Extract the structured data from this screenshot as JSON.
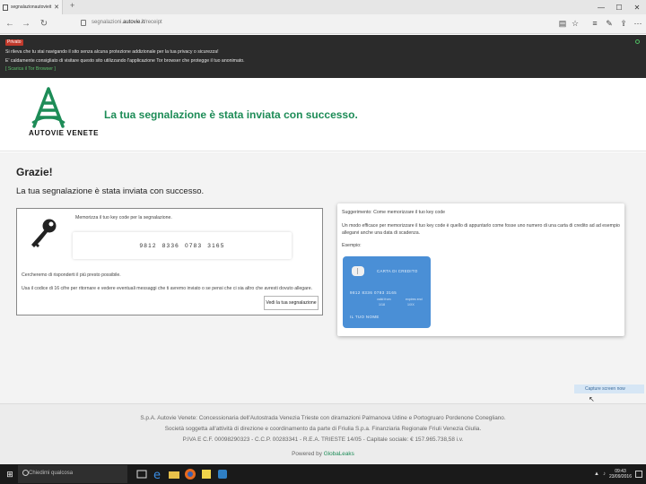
{
  "browser": {
    "tab_title": "segnalazionautovieit",
    "new_tab": "+",
    "window_controls": [
      "—",
      "☐",
      "✕"
    ],
    "url_prefix": "segnalazioni.",
    "url_domain": "autovie.it",
    "url_path": "/receipt",
    "nav": {
      "back": "←",
      "forward": "→",
      "refresh": "↻"
    },
    "toolbar_icons": [
      "reading-view-icon",
      "favorite-icon",
      "hub-icon",
      "note-icon",
      "share-icon",
      "more-icon"
    ]
  },
  "privacy_bar": {
    "badge": "Privato",
    "line1": "Si rileva che tu stai navigando il sito senza alcuna protezione addizionale per la tua privacy o sicurezza!",
    "line2": "E' caldamente consigliato di visitare questo sito utilizzando l'applicazione Tor browser che protegge il tuo anonimato.",
    "link": "[ Scarica il Tor Browser ]"
  },
  "header": {
    "logo_text": "AUTOVIE VENETE",
    "message": "La tua segnalazione è stata inviata con successo.",
    "accent_color": "#1d8c57"
  },
  "main": {
    "title": "Grazie!",
    "subtitle": "La tua segnalazione è stata inviata con successo.",
    "left_card": {
      "memorize": "Memorizza il tuo key code per la segnalazione.",
      "key_code": "9812 8336 0783 3165",
      "response": "Cercheremo di risponderti il più presto possibile.",
      "usage": "Usa il codice di 16 cifre per ritornare e vedere eventuali messaggi che ti avremo inviato o se pensi che ci sia altro che avresti dovuto allegare.",
      "view_button": "Vedi la tua segnalazione"
    },
    "right_card": {
      "tip": "Suggerimento: Come memorizzare il tuo key code",
      "line1": "Un modo efficace per memorizzare il tuo key code è quello di appuntarlo come fosse uno numero di una carta di credito ad ad esempio",
      "line2": "allegarvi anche una data di scadenza.",
      "example": "Esempio:",
      "card": {
        "title": "CARTA DI CREDITO",
        "number": "9812 8336 0783 3165",
        "valid_from_label": "valid from",
        "valid_from": "1/18",
        "expires_label": "expires end",
        "expires": "1/XX",
        "name": "IL TUO NOME",
        "color": "#4a8fd6"
      }
    }
  },
  "capture_button": "Capture screen now",
  "footer": {
    "line1": "S.p.A. Autovie Venete: Concessionaria dell'Autostrada Venezia Trieste con diramazioni Palmanova Udine e Portogruaro Pordenone Conegliano.",
    "line2": "Società soggetta all'attività di direzione e coordinamento da parte di Friulia S.p.a. Finanziaria Regionale Friuli Venezia Giulia.",
    "line3": "P.IVA E C.F. 00098290323 - C.C.P. 00283341 - R.E.A. TRIESTE 14/05 - Capitale sociale: € 157.965.738,58 i.v.",
    "powered_prefix": "Powered by",
    "powered_name": "GlobaLeaks"
  },
  "taskbar": {
    "search_placeholder": "Chiedimi qualcosa",
    "clock_time": "09:43",
    "clock_date": "23/09/2016",
    "tray_icons": [
      "network-icon",
      "volume-icon"
    ]
  }
}
